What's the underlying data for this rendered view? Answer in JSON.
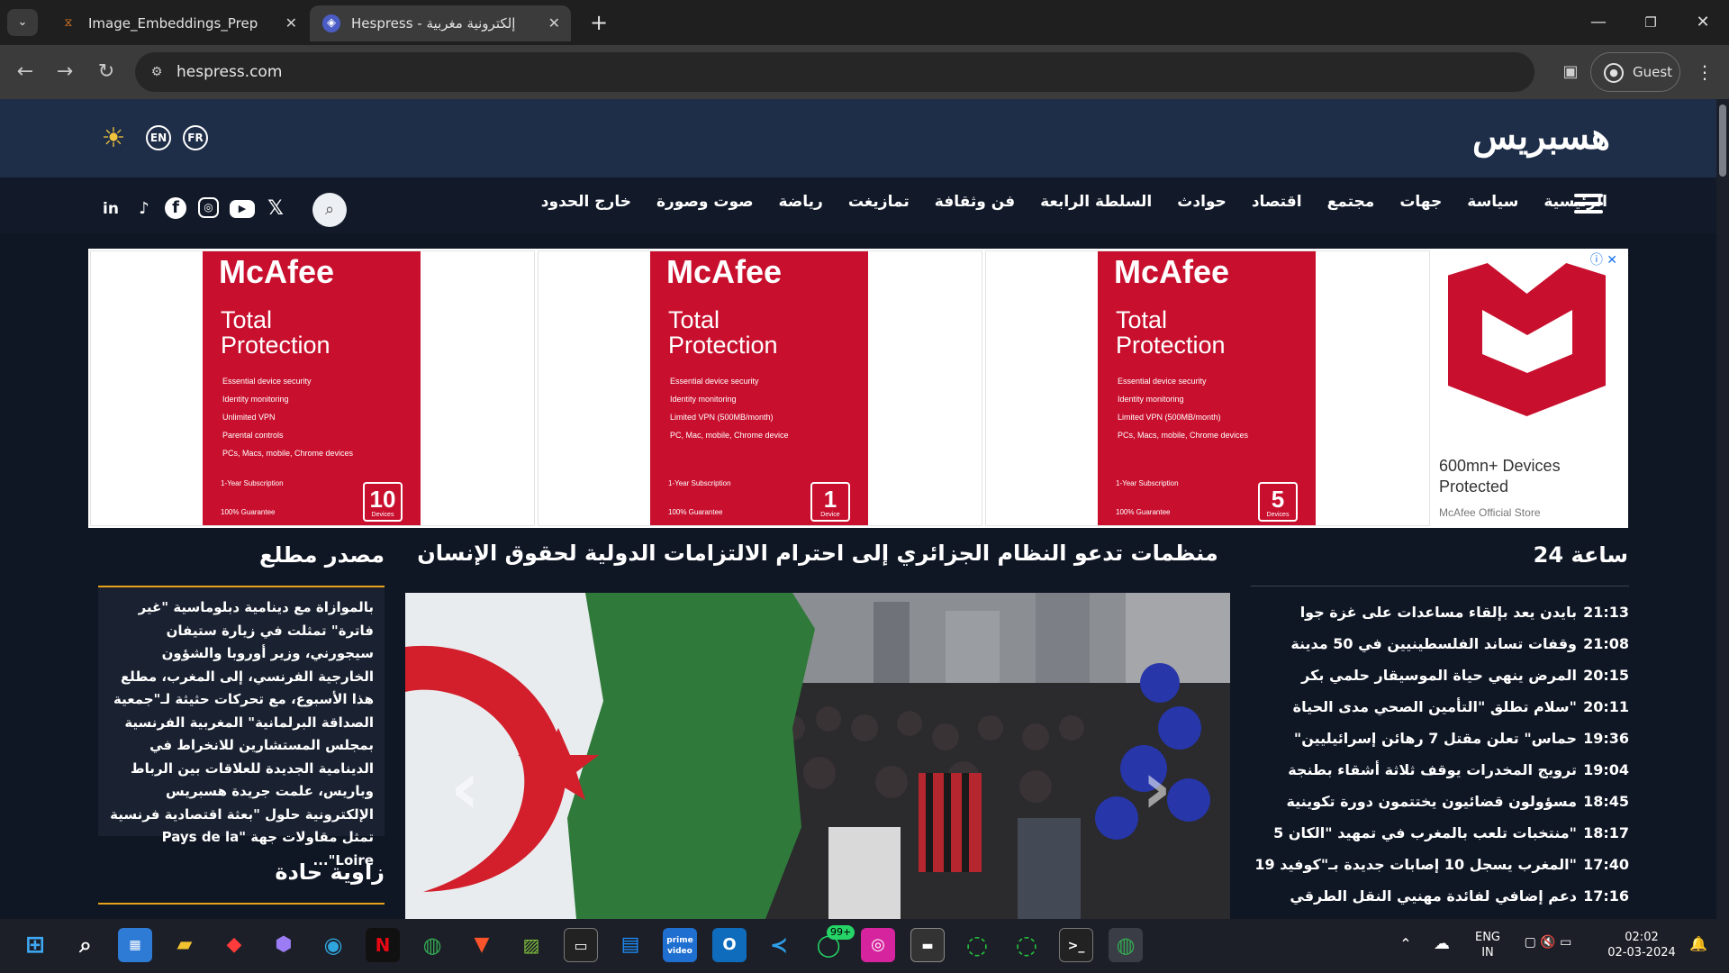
{
  "browser": {
    "tabs": [
      {
        "title": "Image_Embeddings_Prep - Jupyter",
        "icon": "jupyter-icon",
        "active": false
      },
      {
        "title": "Hespress - جريدة إلكترونية مغربية",
        "icon": "hespress-favicon-icon",
        "active": true
      }
    ],
    "url": "hespress.com",
    "profile_label": "Guest"
  },
  "site": {
    "logo": "هسبريس",
    "languages": [
      "EN",
      "FR"
    ],
    "nav": [
      "الرئيسية",
      "سياسة",
      "جهات",
      "مجتمع",
      "اقتصاد",
      "حوادث",
      "السلطة الرابعة",
      "فن وثقافة",
      "تمازيغت",
      "رياضة",
      "صوت وصورة",
      "خارج الحدود"
    ],
    "social": [
      "linkedin-icon",
      "tiktok-icon",
      "facebook-icon",
      "instagram-icon",
      "youtube-icon",
      "x-icon"
    ]
  },
  "ad": {
    "brand": "McAfee",
    "product_line1": "Total",
    "product_line2": "Protection",
    "panels": [
      {
        "features": [
          "Essential device security",
          "Identity monitoring",
          "Unlimited VPN",
          "Parental controls",
          "PCs, Macs, mobile, Chrome devices"
        ],
        "count": "10",
        "unit": "Devices"
      },
      {
        "features": [
          "Essential device security",
          "Identity monitoring",
          "Limited VPN (500MB/month)",
          "PC, Mac, mobile, Chrome device"
        ],
        "count": "1",
        "unit": "Device"
      },
      {
        "features": [
          "Essential device security",
          "Identity monitoring",
          "Limited VPN (500MB/month)",
          "PCs, Macs, mobile, Chrome devices"
        ],
        "count": "5",
        "unit": "Devices"
      }
    ],
    "subscription": "1-Year Subscription",
    "guarantee": "100% Guarantee",
    "claim_line1": "600mn+ Devices",
    "claim_line2": "Protected",
    "store": "McAfee Official Store"
  },
  "latest": {
    "title": "24 ساعة",
    "items": [
      {
        "time": "21:13",
        "headline": "بايدن يعد بإلقاء مساعدات على غزة جوا"
      },
      {
        "time": "21:08",
        "headline": "وقفات تساند الفلسطينيين في 50 مدينة"
      },
      {
        "time": "20:15",
        "headline": "المرض ينهي حياة الموسيقار حلمي بكر"
      },
      {
        "time": "20:11",
        "headline": "سلام تطلق \"التأمين الصحي مدى الحياة\""
      },
      {
        "time": "19:36",
        "headline": "\"حماس\" تعلن مقتل 7 رهائن إسرائيليين"
      },
      {
        "time": "19:04",
        "headline": "ترويج المخدرات يوقف ثلاثة أشقاء بطنجة"
      },
      {
        "time": "18:45",
        "headline": "مسؤولون قضائيون يختتمون دورة تكوينية"
      },
      {
        "time": "18:17",
        "headline": "5 منتخبات تلعب بالمغرب في تمهيد \"الكان\""
      },
      {
        "time": "17:40",
        "headline": "المغرب يسجل 10 إصابات جديدة بـ\"كوفيد 19\""
      },
      {
        "time": "17:16",
        "headline": "دعم إضافي لفائدة مهنيي النقل الطرقي"
      }
    ]
  },
  "feature": {
    "headline": "منظمات تدعو النظام الجزائري إلى احترام الالتزامات الدولية لحقوق الإنسان"
  },
  "source": {
    "title": "مصدر مطلع",
    "text": "بالموازاة مع دينامية دبلوماسية \"غير فاترة\" تمثلت في زيارة ستيفان سيجورني، وزير أوروبا والشؤون الخارجية الفرنسي، إلى المغرب، مطلع هذا الأسبوع، مع تحركات حثيثة لـ\"جمعية الصداقة البرلمانية\" المغربية الفرنسية بمجلس المستشارين للانخراط في الدينامية الجديدة للعلاقات بين الرباط وباريس، علمت جريدة هسبريس الإلكترونية حلول \"بعثة اقتصادية فرنسية تمثل مقاولات جهة \"Pays de la Loire\"...",
    "next_title": "زاوية حادة"
  },
  "taskbar": {
    "badge": "99+",
    "lang1": "ENG",
    "lang2": "IN",
    "time": "02:02",
    "date": "02-03-2024"
  }
}
